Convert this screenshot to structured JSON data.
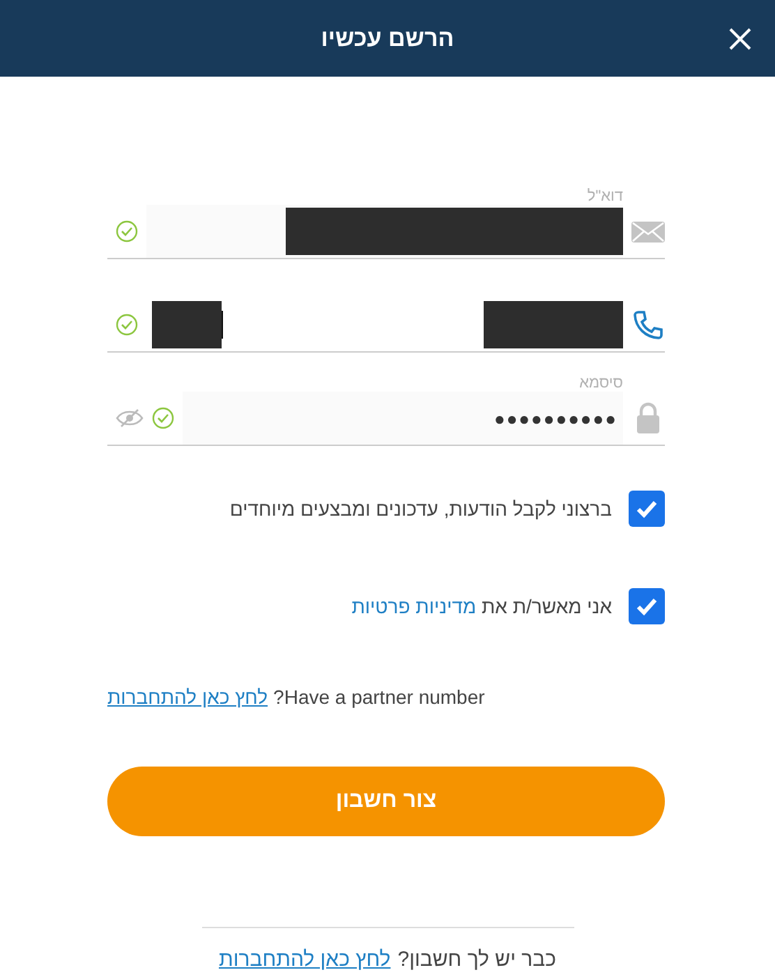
{
  "header": {
    "title": "הרשם עכשיו"
  },
  "fields": [
    {
      "kind": "email",
      "label": "דוא\"ל",
      "focused": false,
      "valid": true
    },
    {
      "kind": "phone",
      "focused": true,
      "valid": true
    },
    {
      "kind": "password",
      "label": "סיסמא",
      "value": "●●●●●●●●●●",
      "focused": false,
      "valid": true
    }
  ],
  "checkboxes": [
    {
      "label": "ברצוני לקבל הודעות, עדכונים ומבצעים מיוחדים",
      "checked": true
    },
    {
      "label": "אני מאשר/ת את",
      "link": "מדיניות פרטיות",
      "checked": true
    }
  ],
  "partner": {
    "text": "Have a partner number?",
    "link": "לחץ כאן להתחברות"
  },
  "submit": "צור חשבון",
  "login": {
    "text": "כבר יש לך חשבון?",
    "link": "לחץ כאן להתחברות"
  }
}
